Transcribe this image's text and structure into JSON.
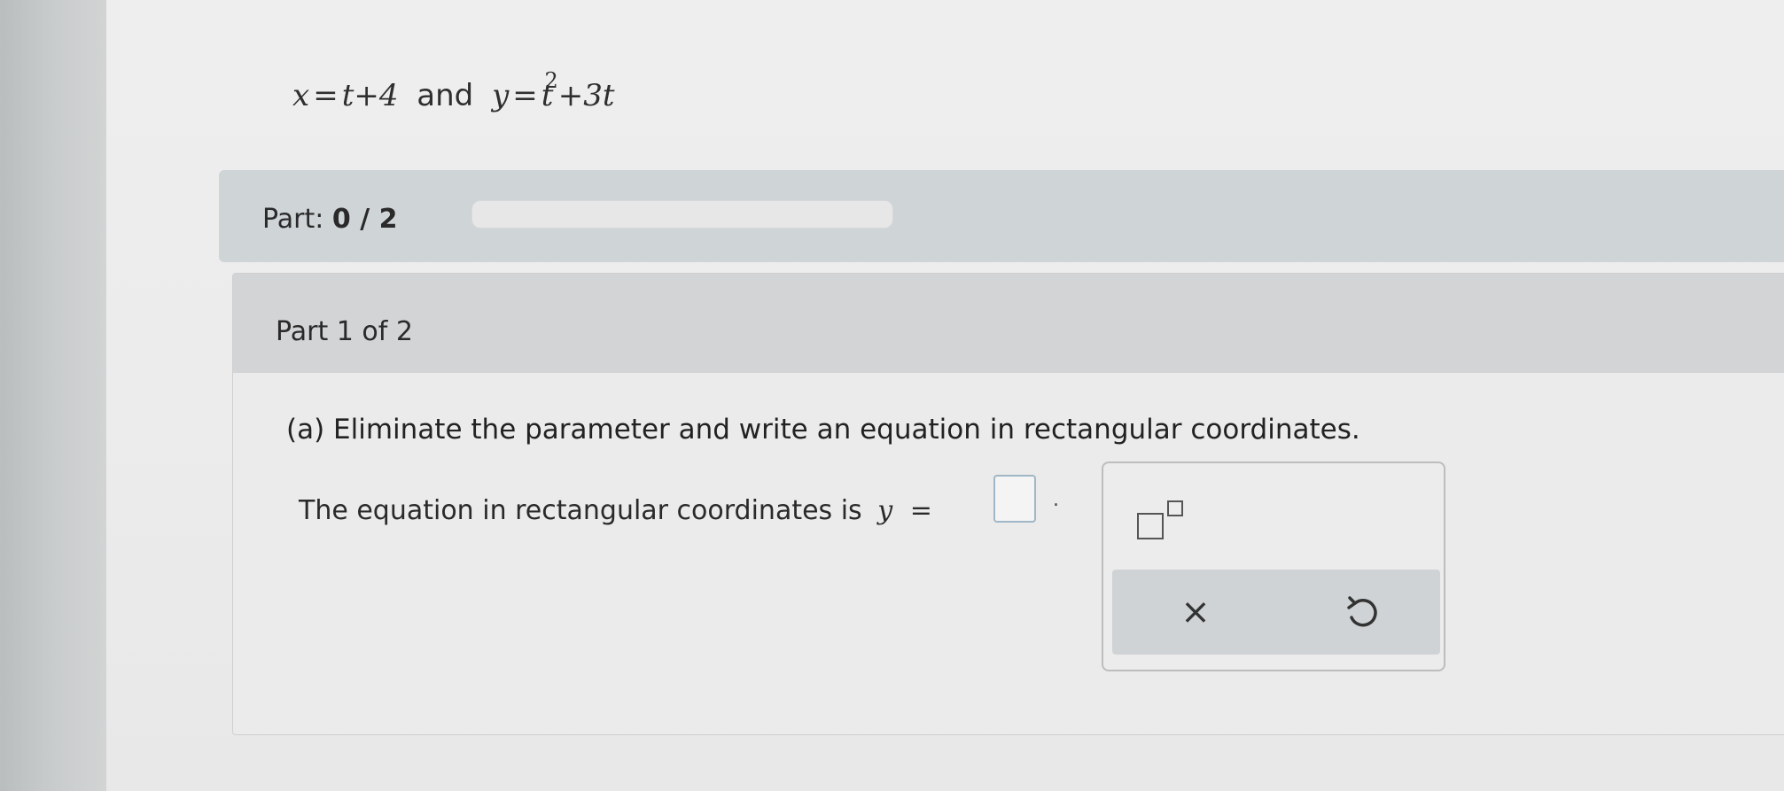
{
  "problem": {
    "x_lhs": "x",
    "x_eq": "=",
    "x_rhs": "t+4",
    "connector": "and",
    "y_lhs": "y",
    "y_eq": "=",
    "y_base": "t",
    "y_exp": "2",
    "y_rest": "+3t"
  },
  "progress": {
    "label": "Part:",
    "value": "0 / 2",
    "fraction": 0
  },
  "part": {
    "title": "Part 1 of 2",
    "question": "(a) Eliminate the parameter and write an equation in rectangular coordinates.",
    "answer_prefix": "The equation in rectangular coordinates is",
    "answer_var": "y",
    "answer_eq": "=",
    "answer_suffix": "."
  },
  "palette": {
    "buttons": [
      {
        "name": "superscript-template",
        "icon": "superscript-icon"
      },
      {
        "name": "clear",
        "icon": "close-icon",
        "glyph": "×"
      },
      {
        "name": "undo",
        "icon": "undo-icon"
      }
    ]
  },
  "colors": {
    "progress_bar_bg": "#cfd4d7",
    "answer_box_border": "#9fb7c6",
    "header_bg": "#d2d4d5"
  }
}
